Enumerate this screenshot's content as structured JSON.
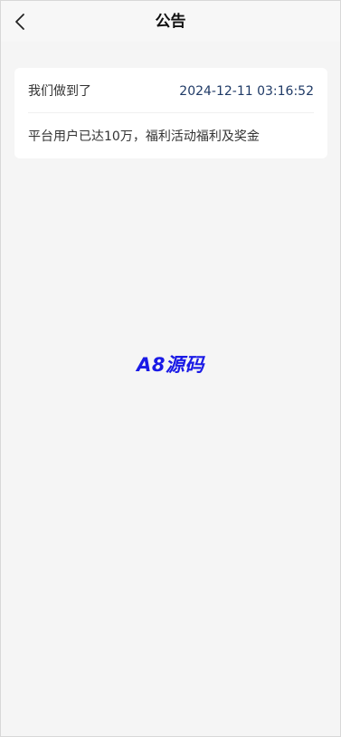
{
  "header": {
    "title": "公告",
    "back_icon": "chevron-left-icon"
  },
  "notices": [
    {
      "title": "我们做到了",
      "time": "2024-12-11 03:16:52",
      "content": "平台用户已达10万，福利活动福利及奖金"
    }
  ],
  "watermark": {
    "text": "A8源码",
    "color": "#1a1ae6"
  }
}
